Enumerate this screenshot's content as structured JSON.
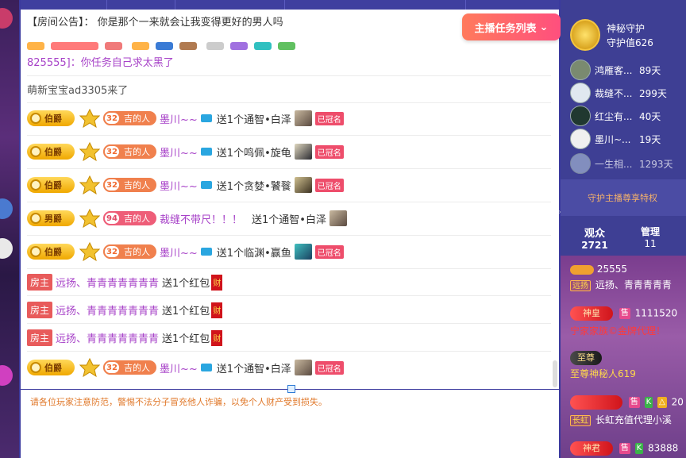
{
  "announcement": {
    "label": "【房间公告】：",
    "text": "你是那个一来就会让我变得更好的男人吗"
  },
  "task_button": {
    "label": "主播任务列表",
    "icon": "chevron-down-icon"
  },
  "messages": {
    "partial": "825555]：你任务自己求太黑了",
    "enter": "萌新宝宝ad3305来了",
    "rows": [
      {
        "rank": "伯爵",
        "fan_level": "32",
        "fan_title": "吉的人",
        "user": "墨川~~",
        "gift": "送1个通智•白泽",
        "tag": "已冠名"
      },
      {
        "rank": "伯爵",
        "fan_level": "32",
        "fan_title": "吉的人",
        "user": "墨川~~",
        "gift": "送1个鸣佩•旋龟",
        "tag": "已冠名"
      },
      {
        "rank": "伯爵",
        "fan_level": "32",
        "fan_title": "吉的人",
        "user": "墨川~~",
        "gift": "送1个贪婪•饕餮",
        "tag": "已冠名"
      },
      {
        "rank": "男爵",
        "fan_level": "94",
        "fan_title": "吉的人",
        "user": "裁缝不带尺！！！",
        "gift": "送1个通智•白泽",
        "tag": ""
      },
      {
        "rank": "伯爵",
        "fan_level": "32",
        "fan_title": "吉的人",
        "user": "墨川~~",
        "gift": "送1个临渊•赢鱼",
        "tag": "已冠名"
      }
    ],
    "host_rows": [
      {
        "tag": "房主",
        "user": "远扬、青青青青青青青",
        "gift": "送1个红包",
        "icon": "财"
      },
      {
        "tag": "房主",
        "user": "远扬、青青青青青青青",
        "gift": "送1个红包",
        "icon": "财"
      },
      {
        "tag": "房主",
        "user": "远扬、青青青青青青青",
        "gift": "送1个红包",
        "icon": "财"
      }
    ],
    "last_row": {
      "rank": "伯爵",
      "fan_level": "32",
      "fan_title": "吉的人",
      "user": "墨川~~",
      "gift": "送1个通智•白泽",
      "tag": "已冠名"
    }
  },
  "warning": "请各位玩家注意防范，警惕不法分子冒充他人诈骗，以免个人财产受到损失。",
  "sidebar": {
    "guard_title": "神秘守护",
    "guard_value": "守护值626",
    "guards": [
      {
        "name": "鸿雁客...",
        "days": "89天"
      },
      {
        "name": "裁缝不...",
        "days": "299天"
      },
      {
        "name": "红尘有...",
        "days": "40天"
      },
      {
        "name": "墨川~...",
        "days": "19天"
      },
      {
        "name": "一生相...",
        "days": "1293天"
      }
    ],
    "privilege": "守护主播尊享特权",
    "viewers_label": "观众",
    "viewers_value": "2721",
    "admin_label": "管理",
    "admin_value": "11",
    "fans": {
      "f1_id": "25555",
      "f1_tag": "远扬",
      "f1_name": "远扬、青青青青青",
      "f2_badge": "神皇",
      "f2_tag": "售",
      "f2_id": "1111520",
      "f2_line": "宁家家族©金牌代理！",
      "f3_badge": "至尊",
      "f3_line": "至尊神秘人619",
      "f4_tags": [
        "售",
        "K",
        "△"
      ],
      "f4_id": "20",
      "f4_tag": "长虹",
      "f4_name": "长虹充值代理小溪",
      "f5_badge": "神君",
      "f5_tags": [
        "售",
        "K"
      ],
      "f5_id": "83888"
    }
  }
}
